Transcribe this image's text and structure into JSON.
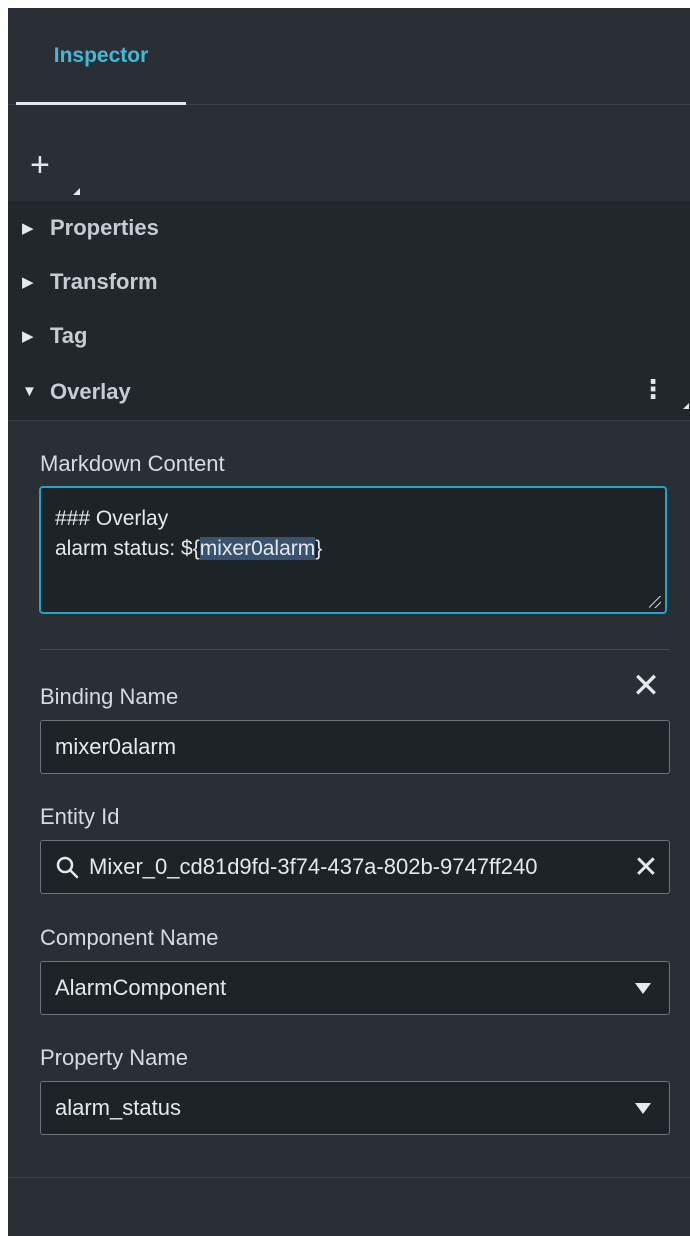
{
  "tabs": [
    {
      "label": "Inspector",
      "active": true
    }
  ],
  "add_button": {
    "glyph": "+",
    "icon": "plus-icon"
  },
  "sections": [
    {
      "label": "Properties",
      "expanded": false
    },
    {
      "label": "Transform",
      "expanded": false
    },
    {
      "label": "Tag",
      "expanded": false
    },
    {
      "label": "Overlay",
      "expanded": true
    }
  ],
  "overlay": {
    "markdown_label": "Markdown Content",
    "markdown_line1": "### Overlay",
    "markdown_line2_prefix": "alarm status: ${",
    "markdown_line2_highlight": "mixer0alarm",
    "markdown_line2_suffix": "}",
    "binding_name_label": "Binding Name",
    "binding_name_value": "mixer0alarm",
    "entity_id_label": "Entity Id",
    "entity_id_value": "Mixer_0_cd81d9fd-3f74-437a-802b-9747ff240",
    "component_name_label": "Component Name",
    "component_name_value": "AlarmComponent",
    "property_name_label": "Property Name",
    "property_name_value": "alarm_status",
    "close_glyph": "✕"
  },
  "colors": {
    "accent": "#44b9d6",
    "focus_border": "#1fa6c4",
    "panel_bg": "#2a2f35",
    "section_bg": "#22272c",
    "input_bg": "#1e2328",
    "highlight": "#39526f"
  }
}
